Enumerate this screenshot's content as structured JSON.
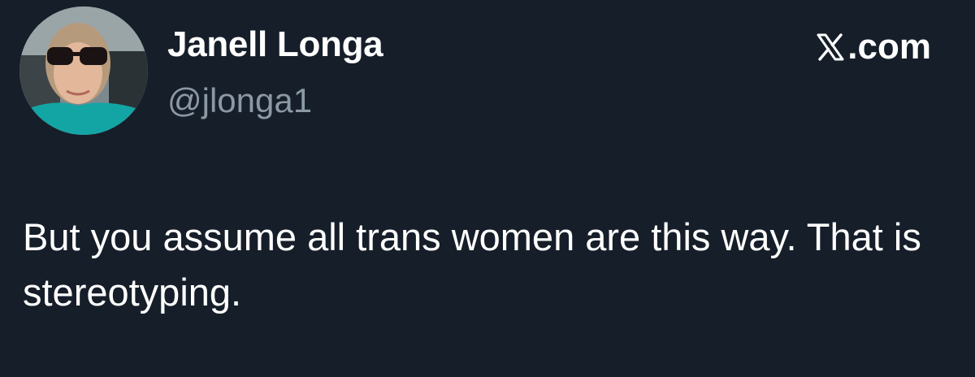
{
  "author": {
    "display_name": "Janell Longa",
    "handle": "@jlonga1"
  },
  "brand": {
    "label": ".com",
    "icon": "x-logo-icon"
  },
  "tweet": {
    "text": "But you assume all trans women are this way. That is stereotyping."
  },
  "colors": {
    "background": "#161e29",
    "text_primary": "#ffffff",
    "text_secondary": "#8b98a5"
  }
}
